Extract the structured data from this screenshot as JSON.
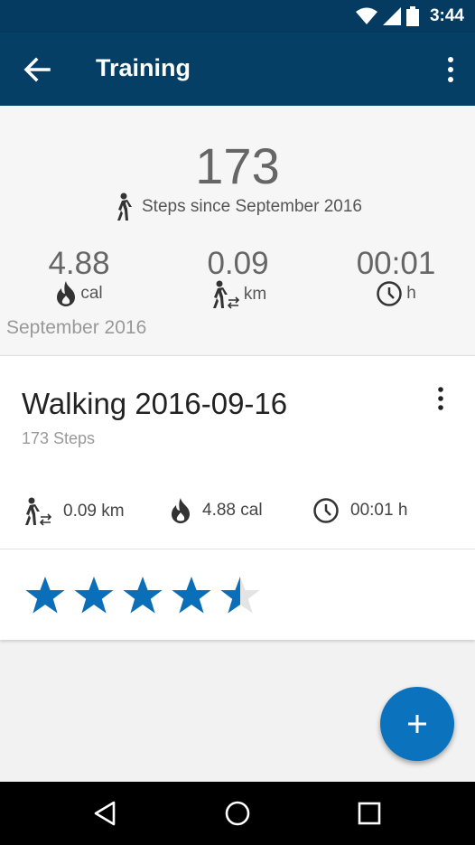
{
  "status": {
    "time": "3:44"
  },
  "appbar": {
    "title": "Training"
  },
  "summary": {
    "steps": "173",
    "steps_caption": "Steps since September 2016",
    "calories": {
      "value": "4.88",
      "unit": "cal"
    },
    "distance": {
      "value": "0.09",
      "unit": "km"
    },
    "duration": {
      "value": "00:01",
      "unit": "h"
    },
    "month_label": "September 2016"
  },
  "entry": {
    "title": "Walking 2016-09-16",
    "subtitle": "173 Steps",
    "distance": "0.09 km",
    "calories": "4.88 cal",
    "duration": "00:01 h"
  },
  "rating": {
    "value": 4.5,
    "max": 5,
    "color": "#0a6fb8"
  },
  "colors": {
    "appbar": "#053f66",
    "accent": "#0b72bd"
  }
}
